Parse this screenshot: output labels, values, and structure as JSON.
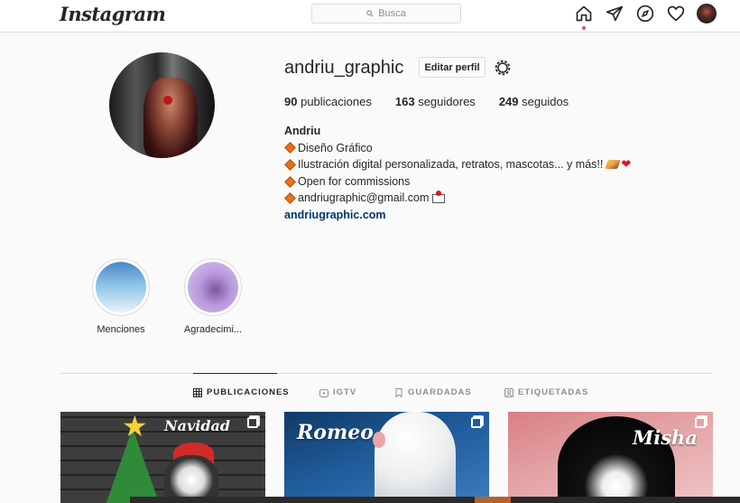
{
  "header": {
    "logo": "Instagram",
    "search_placeholder": "Busca",
    "icons": [
      "home-icon",
      "direct-icon",
      "explore-icon",
      "heart-icon",
      "avatar"
    ]
  },
  "profile": {
    "username": "andriu_graphic",
    "edit_label": "Editar perfil",
    "stats": {
      "posts_count": "90",
      "posts_label": "publicaciones",
      "followers_count": "163",
      "followers_label": "seguidores",
      "following_count": "249",
      "following_label": "seguidos"
    },
    "bio": {
      "name": "Andriu",
      "lines": [
        "Diseño Gráfico",
        "Ilustración digital personalizada, retratos, mascotas... y más!!",
        "Open for commissions",
        "andriugraphic@gmail.com"
      ],
      "website": "andriugraphic.com"
    }
  },
  "highlights": [
    {
      "label": "Menciones"
    },
    {
      "label": "Agradecimi..."
    }
  ],
  "tabs": [
    {
      "label": "PUBLICACIONES",
      "active": true
    },
    {
      "label": "IGTV",
      "active": false
    },
    {
      "label": "GUARDADAS",
      "active": false
    },
    {
      "label": "ETIQUETADAS",
      "active": false
    }
  ],
  "posts": [
    {
      "title": "Navidad"
    },
    {
      "title": "Romeo"
    },
    {
      "title": "Misha"
    }
  ],
  "colors": {
    "accent_link": "#00376b",
    "notification_dot": "#ed4956",
    "border": "#dbdbdb"
  }
}
